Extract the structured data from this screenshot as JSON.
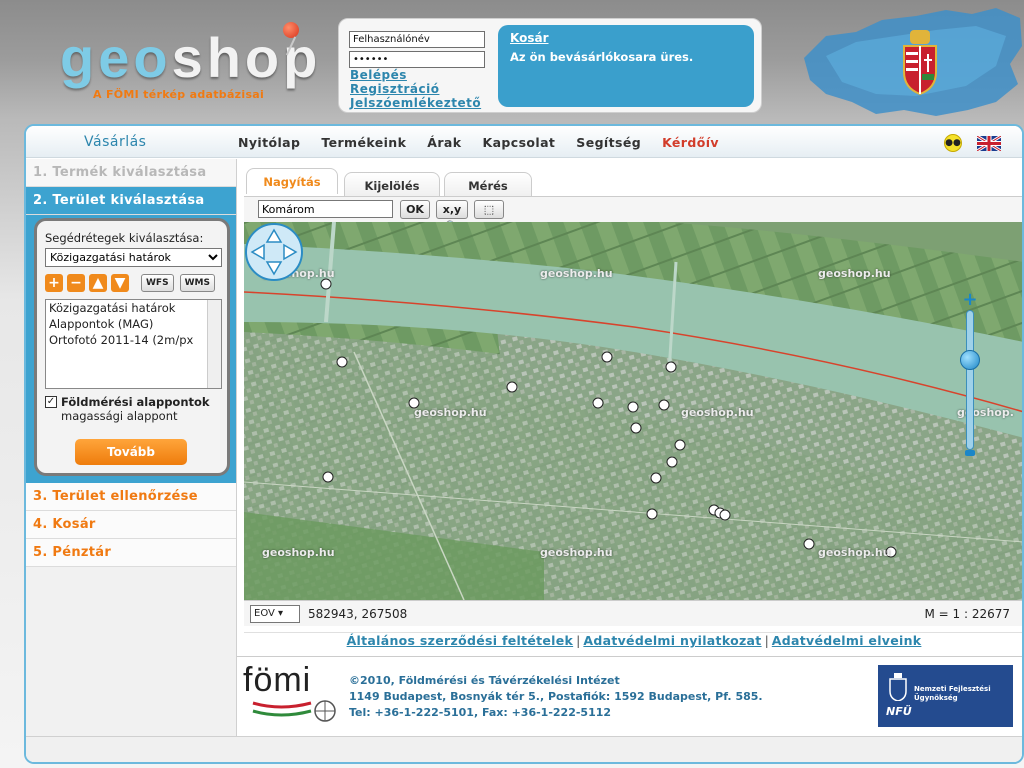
{
  "header": {
    "logo_geo": "geo",
    "logo_shop": "shop",
    "tagline": "A FÖMI térkép adatbázisai",
    "username_value": "Felhasználónév",
    "password_value": "••••••",
    "links": [
      "Belépés",
      "Regisztráció",
      "Jelszóemlékeztető"
    ],
    "cart_title": "Kosár",
    "cart_message": "Az ön bevásárlókosara üres."
  },
  "nav": {
    "title": "Vásárlás",
    "menu": [
      "Nyitólap",
      "Termékeink",
      "Árak",
      "Kapcsolat",
      "Segítség",
      "Kérdőív"
    ],
    "accessibility_icon": "accessibility-icon",
    "language_icon": "uk-flag-icon"
  },
  "sidebar": {
    "steps": [
      "1. Termék kiválasztása",
      "2. Terület kiválasztása",
      "3. Terület ellenőrzése",
      "4. Kosár",
      "5. Pénztár"
    ],
    "panel": {
      "helper_label": "Segédrétegek kiválasztása:",
      "helper_selected": "Közigazgatási határok",
      "wfs_label": "WFS",
      "wms_label": "WMS",
      "layers": [
        "Közigazgatási határok",
        "Alappontok (MAG)",
        "Ortofotó 2011-14 (2m/px"
      ],
      "checkbox_bold": "Földmérési alappontok",
      "checkbox_sub": "magassági alappont",
      "next_label": "Tovább"
    }
  },
  "map": {
    "tabs": [
      "Nagyítás",
      "Kijelölés",
      "Mérés"
    ],
    "search_value": "Komárom",
    "ok_label": "OK",
    "xy_label": "x,y",
    "watermark": "geoshop.hu",
    "watermark_cut": "geoshop.",
    "projection": "EOV",
    "coordinates": "582943, 267508",
    "scale": "M = 1 : 22677"
  },
  "footer": {
    "links": [
      "Általános szerződési feltételek",
      "Adatvédelmi nyilatkozat",
      "Adatvédelmi elveink"
    ],
    "logo": "fömi",
    "line1": "©2010, Földmérési és Távérzékelési Intézet",
    "line2": "1149 Budapest, Bosnyák tér 5., Postafiók: 1592 Budapest, Pf. 585.",
    "line3": "Tel: +36-1-222-5101, Fax: +36-1-222-5112",
    "nfu_short": "NFÜ",
    "nfu_name": "Nemzeti Fejlesztési Ügynökség"
  },
  "colors": {
    "accent_blue": "#3da3d0",
    "accent_orange": "#f08a1c",
    "survey_red": "#d23c2a"
  }
}
